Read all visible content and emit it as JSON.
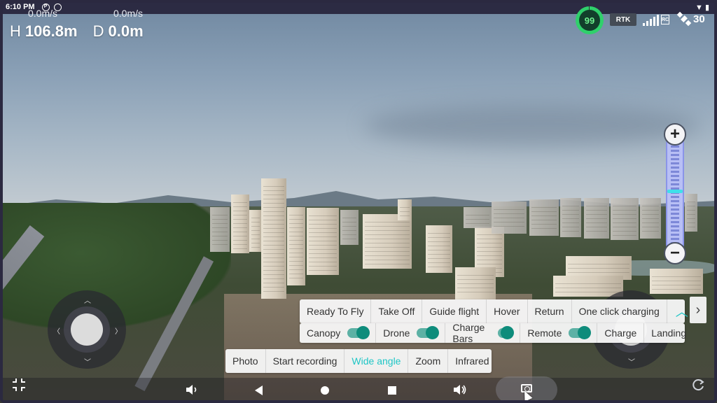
{
  "status_bar": {
    "time": "6:10 PM",
    "left_icons": [
      "parking-icon",
      "alarm-icon"
    ],
    "right_icons": [
      "wifi-icon",
      "battery-icon"
    ]
  },
  "telemetry": {
    "horizontal_speed": "0.0m/s",
    "vertical_speed": "0.0m/s",
    "height_label": "H",
    "height_value": "106.8m",
    "distance_label": "D",
    "distance_value": "0.0m"
  },
  "indicators": {
    "battery_percent": "99",
    "rtk_label": "RTK",
    "rc_label": "RC",
    "satellite_count": "30",
    "battery_color": "#2fd06b"
  },
  "flight_commands": [
    "Ready To Fly",
    "Take Off",
    "Guide flight",
    "Hover",
    "Return",
    "One click charging"
  ],
  "toggles": [
    {
      "label": "Canopy",
      "on": true
    },
    {
      "label": "Drone",
      "on": true
    },
    {
      "label": "Charge Bars",
      "on": true
    },
    {
      "label": "Remote",
      "on": true
    }
  ],
  "extra_commands": [
    "Charge",
    "Landing"
  ],
  "camera_modes": {
    "items": [
      "Photo",
      "Start recording",
      "Wide angle",
      "Zoom",
      "Infrared"
    ],
    "active": "Wide angle"
  },
  "zoom": {
    "level": 0.52
  },
  "colors": {
    "accent": "#1fc6c6",
    "toggle": "#0e8c7b",
    "zoom_track": "#b8bff5"
  }
}
